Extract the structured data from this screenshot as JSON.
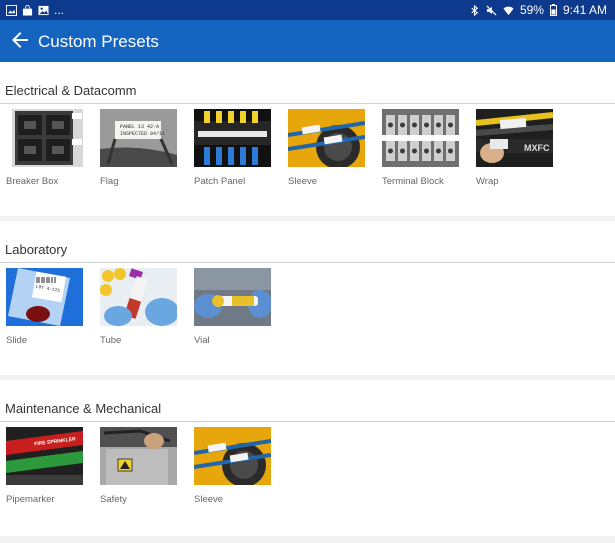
{
  "status": {
    "battery": "59%",
    "time": "9:41 AM",
    "notif": "..."
  },
  "header": {
    "title": "Custom Presets"
  },
  "sections": [
    {
      "title": "Electrical & Datacomm",
      "items": [
        {
          "label": "Breaker Box"
        },
        {
          "label": "Flag"
        },
        {
          "label": "Patch Panel"
        },
        {
          "label": "Sleeve"
        },
        {
          "label": "Terminal Block"
        },
        {
          "label": "Wrap"
        }
      ]
    },
    {
      "title": "Laboratory",
      "items": [
        {
          "label": "Slide"
        },
        {
          "label": "Tube"
        },
        {
          "label": "Vial"
        }
      ]
    },
    {
      "title": "Maintenance & Mechanical",
      "items": [
        {
          "label": "Pipemarker"
        },
        {
          "label": "Safety"
        },
        {
          "label": "Sleeve"
        }
      ]
    }
  ],
  "thumb_text": {
    "flag_line1": "PANEL 13 42-A",
    "flag_line2": "INSPECTED 04/11",
    "wrap_text": "MXFC",
    "slide_text": "LOT 4-125",
    "pipemarker_text": "FIRE SPRINKLER"
  },
  "colors": {
    "status_bar": "#0d3a8c",
    "app_bar": "#1565c0",
    "background": "#f2f2f2"
  }
}
